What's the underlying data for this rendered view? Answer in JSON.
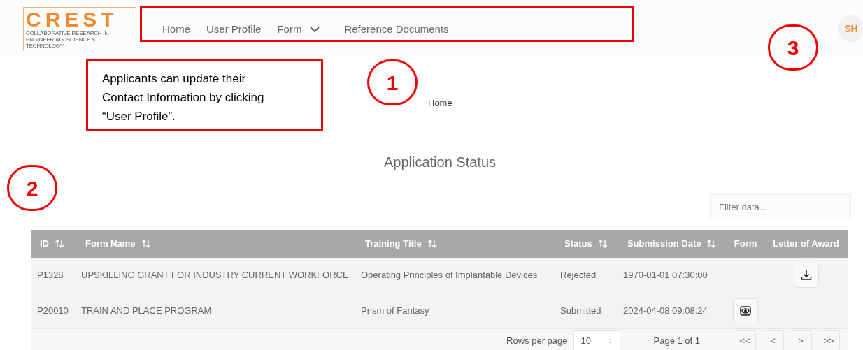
{
  "logo": {
    "name": "CREST",
    "tagline": "COLLABORATIVE RESEARCH IN ENGINEERING, SCIENCE & TECHNOLOGY"
  },
  "nav": [
    {
      "label": "Home",
      "kind": "link"
    },
    {
      "label": "User Profile",
      "kind": "link"
    },
    {
      "label": "Form",
      "kind": "dropdown"
    },
    {
      "label": "Reference Documents",
      "kind": "link"
    }
  ],
  "avatar": "SH",
  "breadcrumb": "Home",
  "title": "Application Status",
  "filter": {
    "placeholder": "Filter data..."
  },
  "table": {
    "columns": [
      {
        "label": "ID",
        "sortable": true
      },
      {
        "label": "Form Name",
        "sortable": true
      },
      {
        "label": "Training Title",
        "sortable": true
      },
      {
        "label": "Status",
        "sortable": true
      },
      {
        "label": "Submission Date",
        "sortable": true
      },
      {
        "label": "Form",
        "sortable": false
      },
      {
        "label": "Letter of Award",
        "sortable": false
      }
    ],
    "rows": [
      {
        "id": "P1328",
        "form_name": "UPSKILLING GRANT FOR INDUSTRY CURRENT WORKFORCE",
        "training_title": "Operating Principles of Implantable Devices",
        "status": "Rejected",
        "submission_date": "1970-01-01 07:30:00",
        "form_view": false,
        "letter_download": true
      },
      {
        "id": "P20010",
        "form_name": "TRAIN AND PLACE PROGRAM",
        "training_title": "Prism of Fantasy",
        "status": "Submitted",
        "submission_date": "2024-04-08 09:08:24",
        "form_view": true,
        "letter_download": false
      }
    ]
  },
  "pagination": {
    "rows_per_page_label": "Rows per page",
    "rows_per_page": "10",
    "page_info": "Page 1 of 1",
    "buttons": [
      "<<",
      "<",
      ">",
      ">>"
    ]
  },
  "annotations": {
    "callout": "Applicants can update their Contact Information by clicking “User Profile”.",
    "markers": [
      "1",
      "2",
      "3"
    ]
  }
}
